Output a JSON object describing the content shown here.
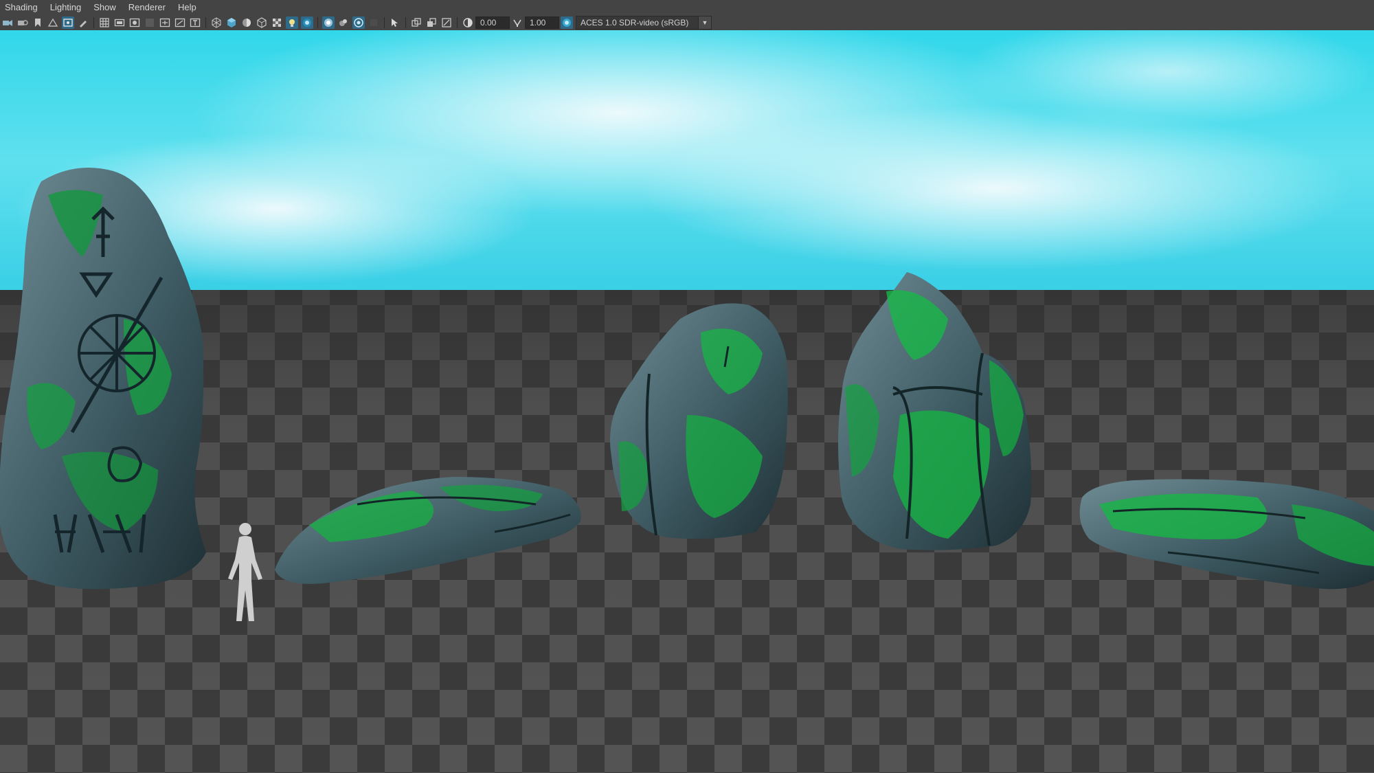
{
  "menubar": {
    "items": [
      "Shading",
      "Lighting",
      "Show",
      "Renderer",
      "Help"
    ]
  },
  "toolbar": {
    "exposure_value": "0.00",
    "gamma_value": "1.00",
    "color_space": "ACES 1.0 SDR-video (sRGB)",
    "icons": [
      "camera-select-icon",
      "camera-attributes-icon",
      "bookmark-icon",
      "image-plane-icon",
      "grid-icon",
      "film-gate-icon",
      "resolution-gate-icon",
      "gate-mask-icon",
      "field-chart-icon",
      "safe-action-icon",
      "safe-title-icon",
      "wireframe-icon",
      "smooth-shade-icon",
      "default-material-icon",
      "textured-icon",
      "use-all-lights-icon",
      "shadows-icon",
      "screen-space-ao-icon",
      "motion-blur-icon",
      "anti-aliasing-icon",
      "depth-of-field-icon",
      "isolate-select-icon",
      "xray-icon",
      "xray-joints-icon",
      "xray-components-icon",
      "exposure-icon",
      "gamma-icon",
      "color-management-icon"
    ]
  },
  "viewport": {
    "colors": {
      "sky_top": "#2ed3e6",
      "sky_cloud": "#e8f7fb",
      "ground_dark": "#3a3a3a",
      "ground_light": "#555555",
      "rock_base": "#3e5a62",
      "moss": "#19b843",
      "figure": "#cfcfcf"
    }
  }
}
